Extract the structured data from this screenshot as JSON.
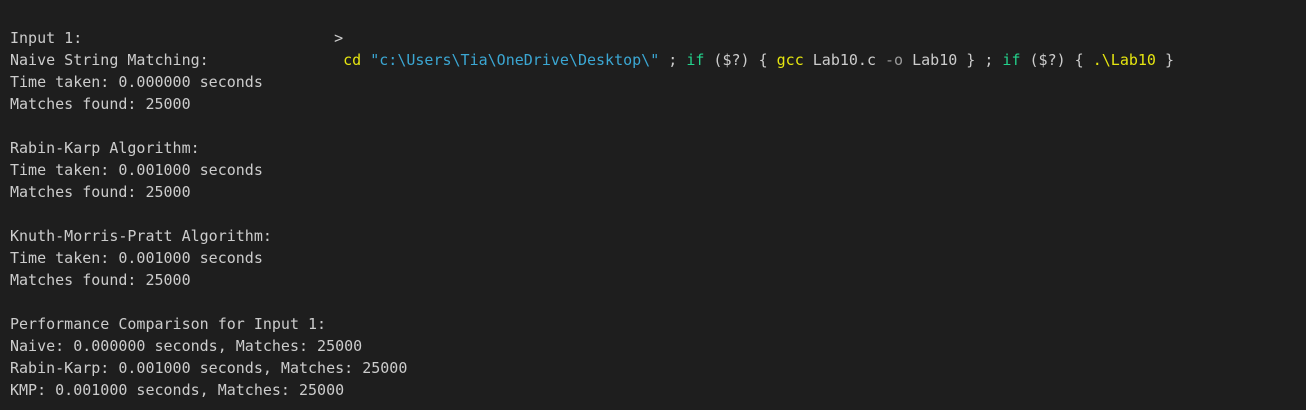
{
  "command": {
    "prompt_symbol": ">",
    "tokens": [
      {
        "text": "cd",
        "color": "#e5e510"
      },
      {
        "text": "\"c:\\Users\\Tia\\OneDrive\\Desktop\\\"",
        "color": "#3ba7d3"
      },
      {
        "text": ";",
        "color": "#cccccc"
      },
      {
        "text": "if",
        "color": "#23d18b"
      },
      {
        "text": "($?)",
        "color": "#cccccc"
      },
      {
        "text": "{",
        "color": "#cccccc"
      },
      {
        "text": "gcc",
        "color": "#e5e510"
      },
      {
        "text": "Lab10.c",
        "color": "#cccccc"
      },
      {
        "text": "-o",
        "color": "#9a9a9a"
      },
      {
        "text": "Lab10",
        "color": "#cccccc"
      },
      {
        "text": "}",
        "color": "#cccccc"
      },
      {
        "text": ";",
        "color": "#cccccc"
      },
      {
        "text": "if",
        "color": "#23d18b"
      },
      {
        "text": "($?)",
        "color": "#cccccc"
      },
      {
        "text": "{",
        "color": "#cccccc"
      },
      {
        "text": ".\\Lab10",
        "color": "#e5e510"
      },
      {
        "text": "}",
        "color": "#cccccc"
      }
    ]
  },
  "output_lines": [
    "Input 1:",
    "Naive String Matching:",
    "Time taken: 0.000000 seconds",
    "Matches found: 25000",
    "",
    "Rabin-Karp Algorithm:",
    "Time taken: 0.001000 seconds",
    "Matches found: 25000",
    "",
    "Knuth-Morris-Pratt Algorithm:",
    "Time taken: 0.001000 seconds",
    "Matches found: 25000",
    "",
    "Performance Comparison for Input 1:",
    "Naive: 0.000000 seconds, Matches: 25000",
    "Rabin-Karp: 0.001000 seconds, Matches: 25000",
    "KMP: 0.001000 seconds, Matches: 25000"
  ],
  "colors": {
    "background": "#1e1e1e",
    "foreground": "#cccccc",
    "command_yellow": "#e5e510",
    "string_cyan": "#3ba7d3",
    "keyword_green": "#23d18b",
    "flag_gray": "#9a9a9a"
  }
}
